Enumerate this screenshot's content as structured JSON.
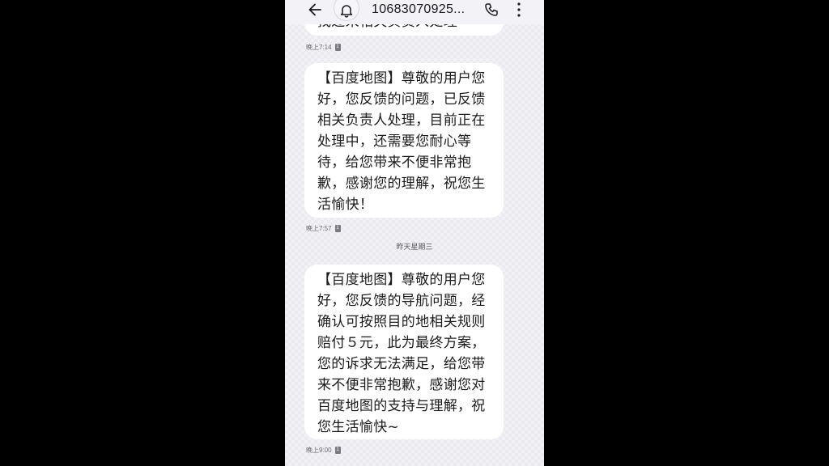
{
  "header": {
    "back_icon": "arrow-left-icon",
    "notify_icon": "bell-icon",
    "contact": "10683070925...",
    "call_icon": "phone-icon",
    "more_icon": "more-vertical-icon"
  },
  "messages": [
    {
      "text": "找过来相关负责人处理",
      "partial": true
    },
    {
      "time": "晚上7:14",
      "sim": "1"
    },
    {
      "text": "【百度地图】尊敬的用户您好，您反馈的问题，已反馈相关负责人处理，目前正在处理中，还需要您耐心等待，给您带来不便非常抱歉，感谢您的理解，祝您生活愉快！",
      "time": "晚上7:57",
      "sim": "1"
    },
    {
      "text": "【百度地图】尊敬的用户您好，您反馈的导航问题，经确认可按照目的地相关规则赔付５元，此为最终方案，您的诉求无法满足，给您带来不便非常抱歉，感谢您对百度地图的支持与理解，祝您生活愉快~",
      "time": "晚上9:00",
      "sim": "1"
    }
  ],
  "date_divider": "昨天星期三"
}
